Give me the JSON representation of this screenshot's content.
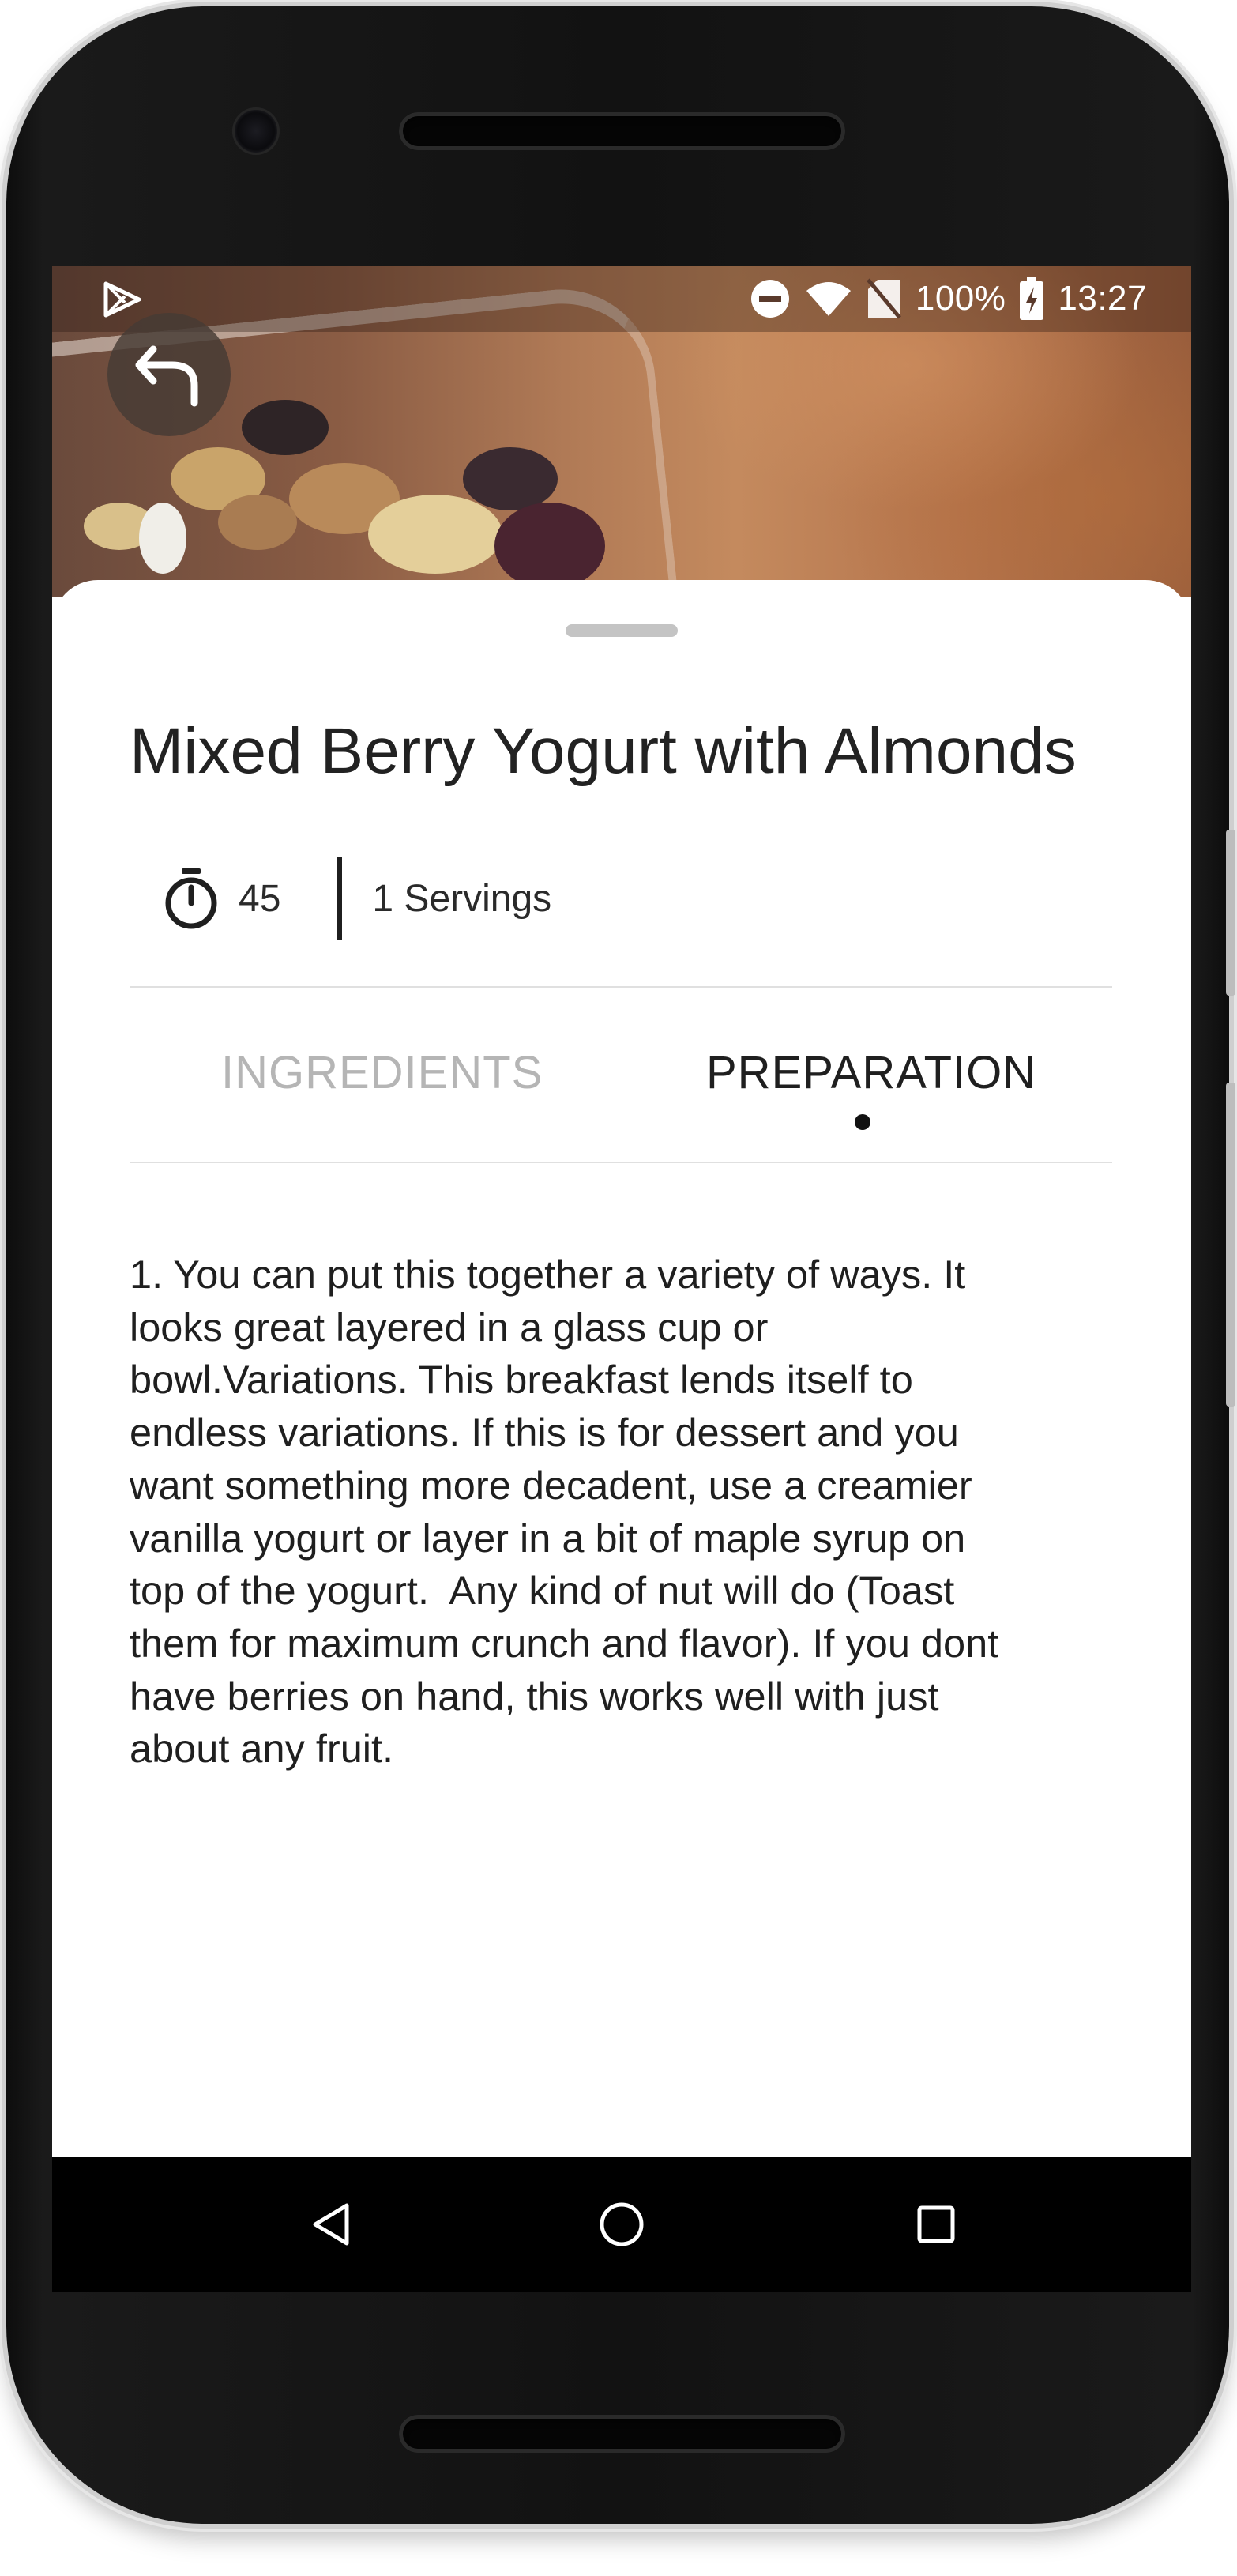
{
  "status_bar": {
    "battery": "100%",
    "time": "13:27",
    "icons": [
      "play-store-icon",
      "do-not-disturb-icon",
      "wifi-icon",
      "no-sim-icon",
      "battery-charging-icon"
    ]
  },
  "recipe": {
    "title": "Mixed Berry Yogurt with Almonds",
    "time": "45",
    "servings": "1 Servings"
  },
  "tabs": [
    {
      "label": "INGREDIENTS",
      "selected": false
    },
    {
      "label": "PREPARATION",
      "selected": true
    }
  ],
  "preparation_text": "1. You can put this together a variety of ways. It\nlooks great layered in a glass cup or\nbowl.Variations. This breakfast lends itself to\nendless variations. If this is for dessert and you\nwant something more decadent, use a creamier\nvanilla yogurt or layer in a bit of maple syrup on\ntop of the yogurt.  Any kind of nut will do (Toast\nthem for maximum crunch and flavor). If you dont\nhave berries on hand, this works well with just\nabout any fruit.",
  "navigation": {
    "buttons": [
      "back-triangle-icon",
      "home-circle-icon",
      "recents-square-icon"
    ]
  },
  "colors": {
    "title_text": "#222222",
    "tab_active": "#1f1f1f",
    "tab_inactive": "#b5b5b5",
    "navbar": "#000000"
  }
}
